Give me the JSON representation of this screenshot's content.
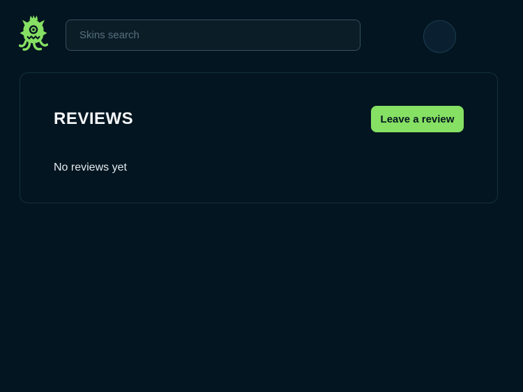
{
  "header": {
    "logo_icon": "monster-crown-logo",
    "search": {
      "placeholder": "Skins search",
      "value": ""
    }
  },
  "reviews_card": {
    "title": "REVIEWS",
    "button_label": "Leave a review",
    "empty_message": "No reviews yet"
  },
  "colors": {
    "background": "#031520",
    "accent_green": "#86e063",
    "button_text": "#04161f",
    "card_border": "#14323e",
    "input_border": "#35505e",
    "placeholder_text": "#56707e",
    "heading_text": "#f4f7f9"
  }
}
